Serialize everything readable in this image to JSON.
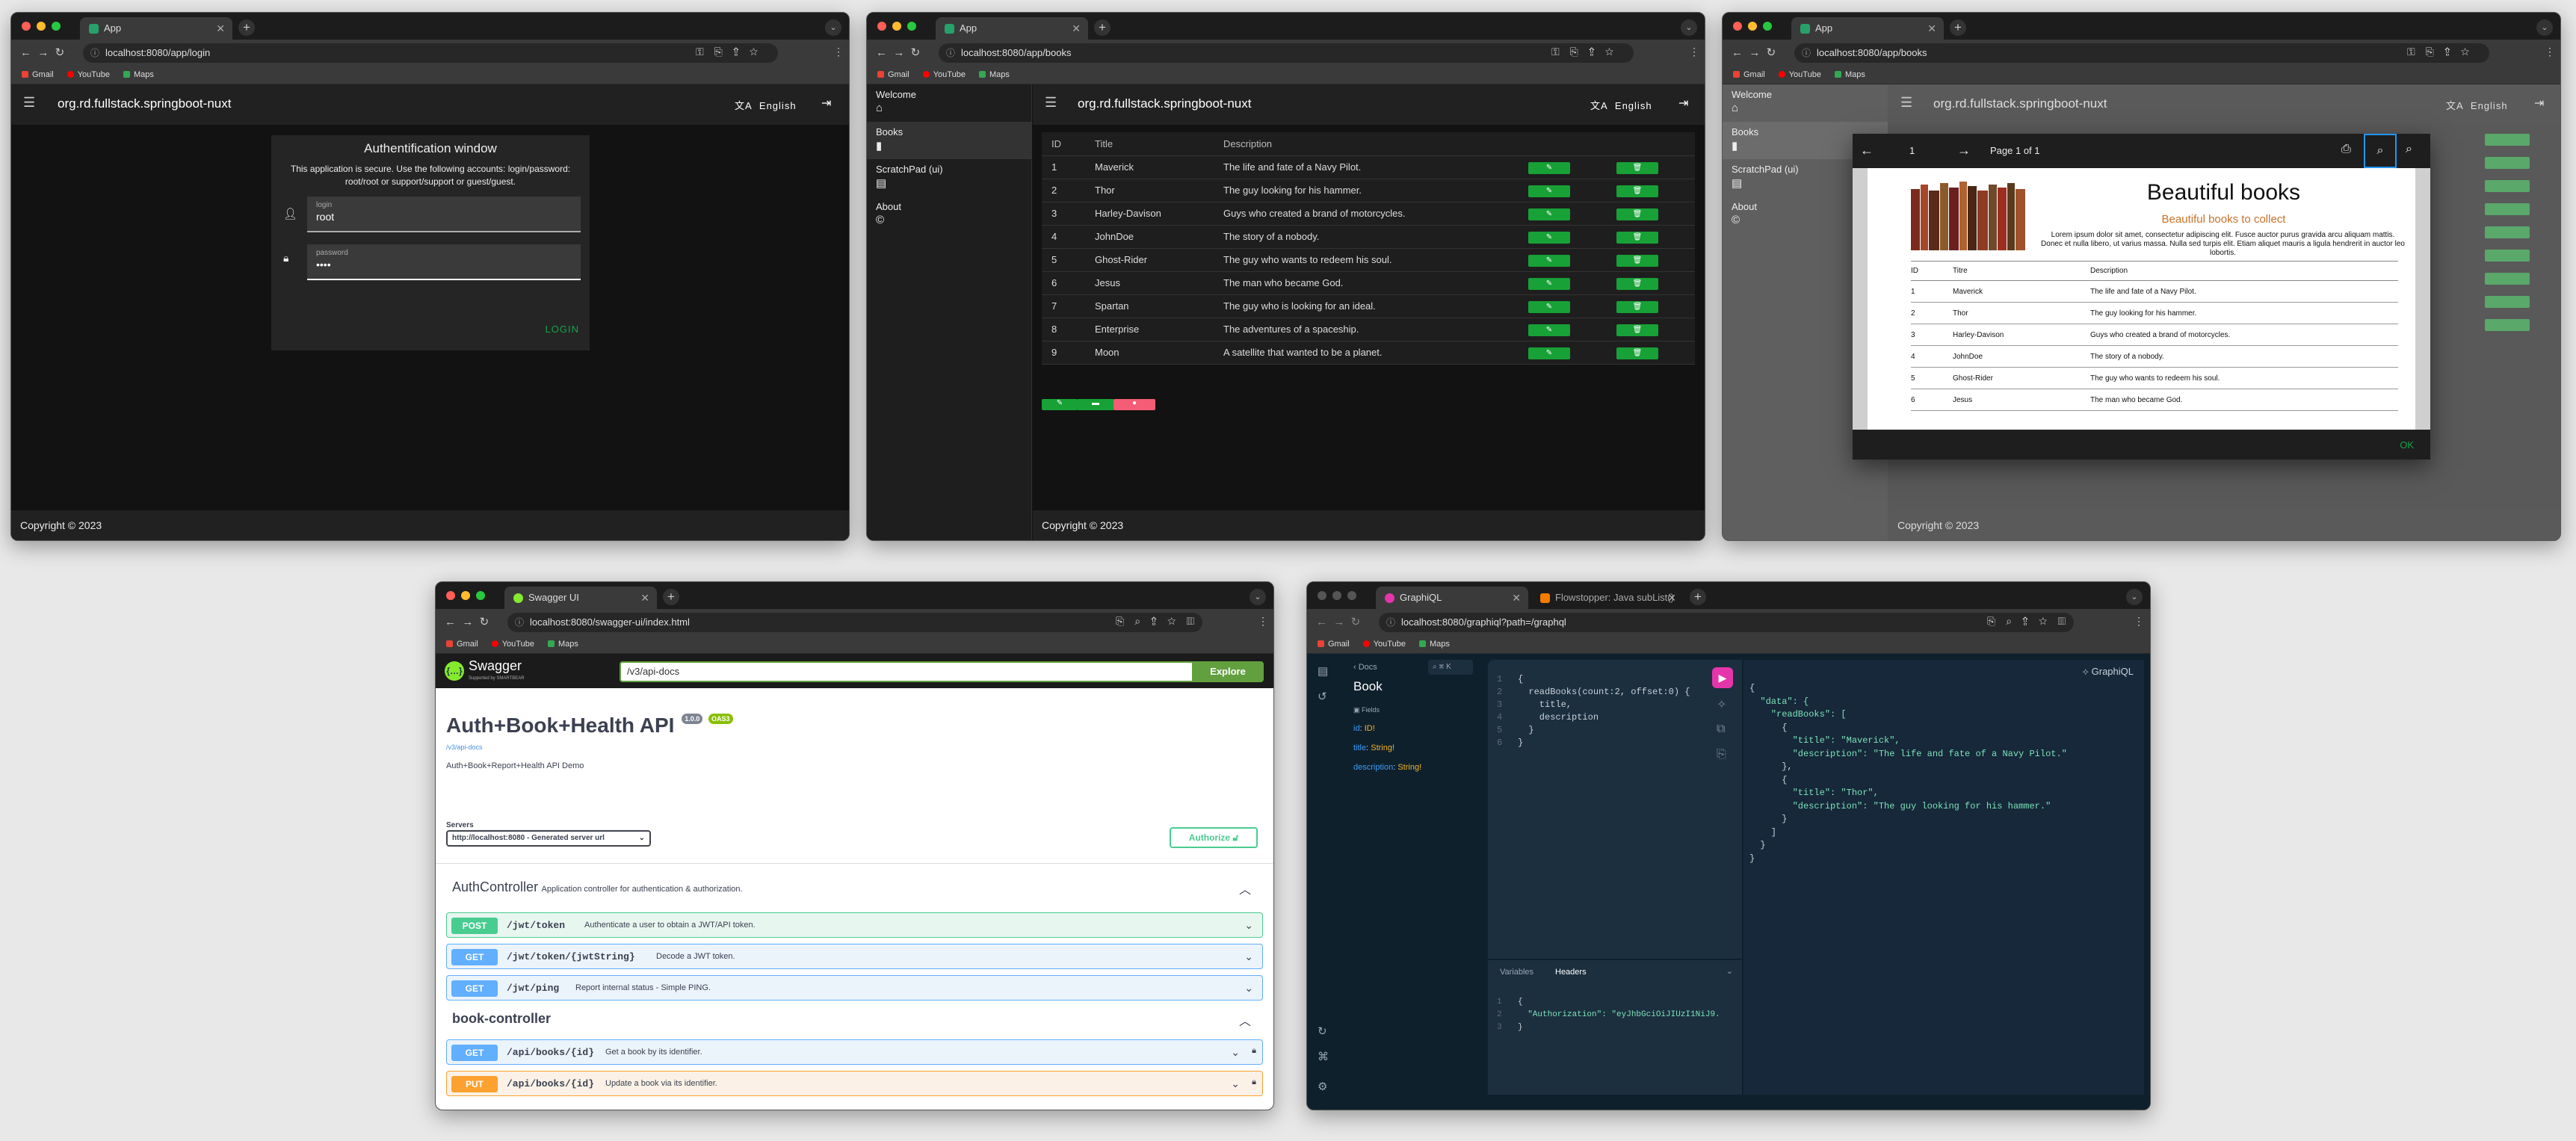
{
  "browser": {
    "tab_app": "App",
    "tab_swagger": "Swagger UI",
    "tab_graphiql": "GraphiQL",
    "tab_flowstopper": "Flowstopper: Java subList() ",
    "bookmarks": [
      "Gmail",
      "YouTube",
      "Maps"
    ]
  },
  "w1": {
    "url": "localhost:8080/app/login",
    "title": "org.rd.fullstack.springboot-nuxt",
    "lang": "English",
    "dialog_title": "Authentification window",
    "dialog_text1": "This application is secure. Use the following accounts: login/password:",
    "dialog_text2": "root/root or support/support or guest/guest.",
    "login_label": "login",
    "login_value": "root",
    "password_label": "password",
    "password_value": "••••",
    "login_button": "LOGIN",
    "footer": "Copyright © 2023"
  },
  "w2": {
    "url": "localhost:8080/app/books",
    "title": "org.rd.fullstack.springboot-nuxt",
    "lang": "English",
    "footer": "Copyright © 2023",
    "menu": [
      {
        "label": "Welcome",
        "icon": "⌂"
      },
      {
        "label": "Books",
        "icon": "▮"
      },
      {
        "label": "ScratchPad (ui)",
        "icon": "▤"
      },
      {
        "label": "About",
        "icon": "©"
      }
    ],
    "columns": [
      "ID",
      "Title",
      "Description"
    ],
    "rows": [
      [
        "1",
        "Maverick",
        "The life and fate of a Navy Pilot."
      ],
      [
        "2",
        "Thor",
        "The guy looking for his hammer."
      ],
      [
        "3",
        "Harley-Davison",
        "Guys who created a brand of motorcycles."
      ],
      [
        "4",
        "JohnDoe",
        "The story of a nobody."
      ],
      [
        "5",
        "Ghost-Rider",
        "The guy who wants to redeem his soul."
      ],
      [
        "6",
        "Jesus",
        "The man who became God."
      ],
      [
        "7",
        "Spartan",
        "The guy who is looking for an ideal."
      ],
      [
        "8",
        "Enterprise",
        "The adventures of a spaceship."
      ],
      [
        "9",
        "Moon",
        "A satellite that wanted to be a planet."
      ]
    ]
  },
  "w3": {
    "url": "localhost:8080/app/books",
    "title": "org.rd.fullstack.springboot-nuxt",
    "lang": "English",
    "footer": "Copyright © 2023",
    "pdf_page_num": "1",
    "pdf_page_label": "Page 1 of 1",
    "pdf_title": "Beautiful books",
    "pdf_subtitle": "Beautiful books to collect",
    "pdf_lorem": "Lorem ipsum dolor sit amet, consectetur adipiscing elit. Fusce auctor purus gravida arcu aliquam mattis. Donec et nulla libero, ut varius massa. Nulla sed turpis elit. Etiam aliquet mauris a ligula hendrerit in auctor leo lobortis.",
    "pdf_columns": [
      "ID",
      "Titre",
      "Description"
    ],
    "pdf_rows": [
      [
        "1",
        "Maverick",
        "The life and fate of a Navy Pilot."
      ],
      [
        "2",
        "Thor",
        "The guy looking for his hammer."
      ],
      [
        "3",
        "Harley-Davison",
        "Guys who created a brand of motorcycles."
      ],
      [
        "4",
        "JohnDoe",
        "The story of a nobody."
      ],
      [
        "5",
        "Ghost-Rider",
        "The guy who wants to redeem his soul."
      ],
      [
        "6",
        "Jesus",
        "The man who became God."
      ]
    ],
    "ok_button": "OK"
  },
  "w4": {
    "url": "localhost:8080/swagger-ui/index.html",
    "logo": "Swagger",
    "logo_sub": "Supported by SMARTBEAR",
    "search_value": "/v3/api-docs",
    "explore": "Explore",
    "api_title": "Auth+Book+Health API",
    "version": "1.0.0",
    "oas": "OAS3",
    "docs_link": "/v3/api-docs",
    "api_desc": "Auth+Book+Report+Health API Demo",
    "servers_label": "Servers",
    "server_value": "http://localhost:8080 - Generated server url",
    "authorize": "Authorize",
    "sections": [
      {
        "name": "AuthController",
        "desc": "Application controller for authentication & authorization."
      },
      {
        "name": "book-controller",
        "desc": ""
      }
    ],
    "ops": [
      {
        "method": "POST",
        "path": "/jwt/token",
        "desc": "Authenticate a user to obtain a JWT/API token."
      },
      {
        "method": "GET",
        "path": "/jwt/token/{jwtString}",
        "desc": "Decode a JWT token."
      },
      {
        "method": "GET",
        "path": "/jwt/ping",
        "desc": "Report internal status - Simple PING."
      },
      {
        "method": "GET",
        "path": "/api/books/{id}",
        "desc": "Get a book by its identifier."
      },
      {
        "method": "PUT",
        "path": "/api/books/{id}",
        "desc": "Update a book via its identifier."
      }
    ]
  },
  "w5": {
    "url": "localhost:8080/graphiql?path=/graphql",
    "docs_back": "Docs",
    "docs_shortcut": "⌘ K",
    "type_name": "Book",
    "fields_label": "Fields",
    "fields": [
      {
        "name": "id",
        "type": "ID!"
      },
      {
        "name": "title",
        "type": "String!"
      },
      {
        "name": "description",
        "type": "String!"
      }
    ],
    "brand": "GraphiQL",
    "query": [
      "{",
      "  readBooks(count:2, offset:0) {",
      "    title,",
      "    description",
      "  }",
      "}"
    ],
    "result": [
      "{",
      "  \"data\": {",
      "    \"readBooks\": [",
      "      {",
      "        \"title\": \"Maverick\",",
      "        \"description\": \"The life and fate of a Navy Pilot.\"",
      "      },",
      "      {",
      "        \"title\": \"Thor\",",
      "        \"description\": \"The guy looking for his hammer.\"",
      "      }",
      "    ]",
      "  }",
      "}"
    ],
    "tab_variables": "Variables",
    "tab_headers": "Headers",
    "headers_lines": [
      "{",
      "  \"Authorization\": \"eyJhbGciOiJIUzI1NiJ9.",
      "}"
    ]
  }
}
